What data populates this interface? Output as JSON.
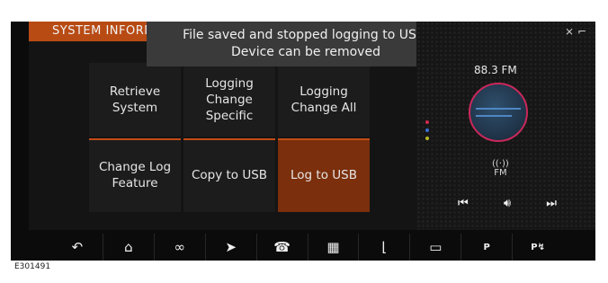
{
  "header": {
    "title": "SYSTEM INFORM"
  },
  "toast": {
    "line1": "File saved and stopped logging to USB.",
    "line2": "Device can be removed"
  },
  "tiles": [
    {
      "label": "Retrieve\nSystem"
    },
    {
      "label": "Logging\nChange\nSpecific"
    },
    {
      "label": "Logging\nChange All"
    },
    {
      "label": "Change Log\nFeature"
    },
    {
      "label": "Copy to USB"
    },
    {
      "label": "Log to USB"
    }
  ],
  "radio": {
    "station": "88.3 FM",
    "band": "FM"
  },
  "pager_colors": [
    "#d02a4e",
    "#3a6fd0",
    "#b8b820"
  ],
  "caption": "E301491",
  "nav": [
    {
      "icon": "back-icon",
      "glyph": "⤺"
    },
    {
      "icon": "home-icon",
      "glyph": "⌂"
    },
    {
      "icon": "connectivity-icon",
      "glyph": "∞"
    },
    {
      "icon": "navigation-icon",
      "glyph": "➤"
    },
    {
      "icon": "phone-icon",
      "glyph": "☎"
    },
    {
      "icon": "media-icon",
      "glyph": "▦"
    },
    {
      "icon": "seat-icon",
      "glyph": "♨"
    },
    {
      "icon": "camera-icon",
      "glyph": "▭"
    },
    {
      "icon": "parking-aid-icon",
      "glyph": "P"
    },
    {
      "icon": "park-assist-icon",
      "glyph": "P↯"
    }
  ]
}
